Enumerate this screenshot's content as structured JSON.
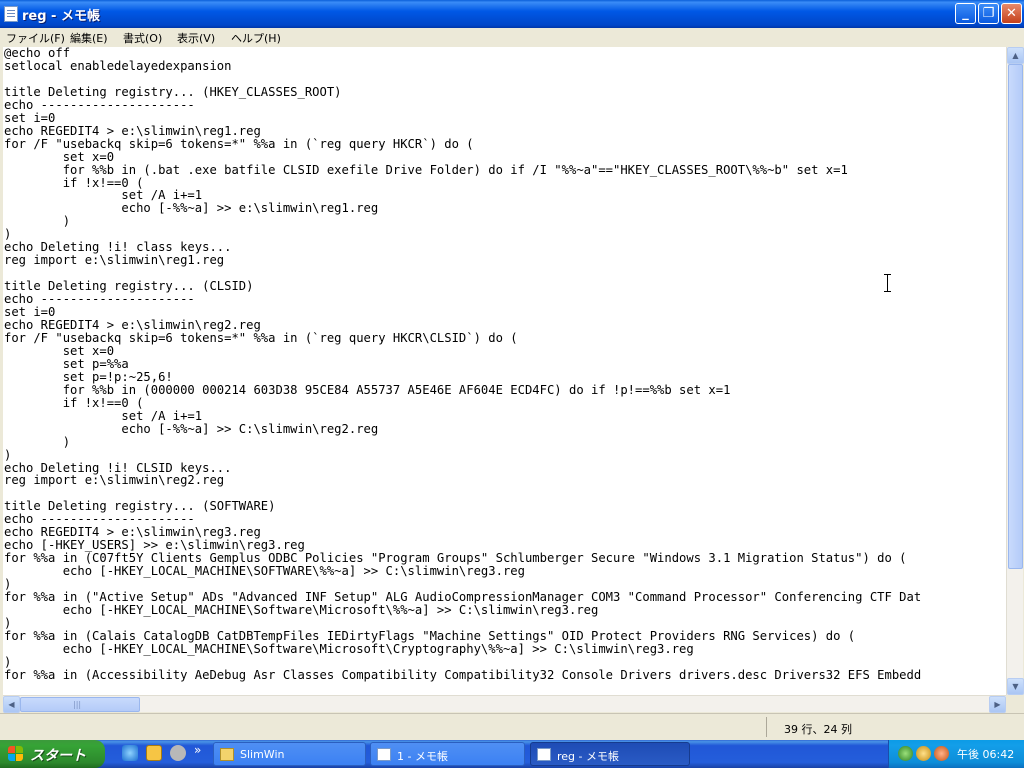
{
  "window": {
    "title": "reg - メモ帳",
    "min_glyph": "_",
    "max_glyph": "❐",
    "close_glyph": "✕"
  },
  "menu": {
    "file": "ファイル(F)",
    "edit": "編集(E)",
    "format": "書式(O)",
    "view": "表示(V)",
    "help": "ヘルプ(H)"
  },
  "editor": {
    "text": "@echo off\nsetlocal enabledelayedexpansion\n\ntitle Deleting registry... (HKEY_CLASSES_ROOT)\necho ---------------------\nset i=0\necho REGEDIT4 > e:\\slimwin\\reg1.reg\nfor /F \"usebackq skip=6 tokens=*\" %%a in (`reg query HKCR`) do (\n        set x=0\n        for %%b in (.bat .exe batfile CLSID exefile Drive Folder) do if /I \"%%~a\"==\"HKEY_CLASSES_ROOT\\%%~b\" set x=1\n        if !x!==0 (\n                set /A i+=1\n                echo [-%%~a] >> e:\\slimwin\\reg1.reg\n        )\n)\necho Deleting !i! class keys...\nreg import e:\\slimwin\\reg1.reg\n\ntitle Deleting registry... (CLSID)\necho ---------------------\nset i=0\necho REGEDIT4 > e:\\slimwin\\reg2.reg\nfor /F \"usebackq skip=6 tokens=*\" %%a in (`reg query HKCR\\CLSID`) do (\n        set x=0\n        set p=%%a\n        set p=!p:~25,6!\n        for %%b in (000000 000214 603D38 95CE84 A55737 A5E46E AF604E ECD4FC) do if !p!==%%b set x=1\n        if !x!==0 (\n                set /A i+=1\n                echo [-%%~a] >> C:\\slimwin\\reg2.reg\n        )\n)\necho Deleting !i! CLSID keys...\nreg import e:\\slimwin\\reg2.reg\n\ntitle Deleting registry... (SOFTWARE)\necho ---------------------\necho REGEDIT4 > e:\\slimwin\\reg3.reg\necho [-HKEY_USERS] >> e:\\slimwin\\reg3.reg\nfor %%a in (C07ft5Y Clients Gemplus ODBC Policies \"Program Groups\" Schlumberger Secure \"Windows 3.1 Migration Status\") do (\n        echo [-HKEY_LOCAL_MACHINE\\SOFTWARE\\%%~a] >> C:\\slimwin\\reg3.reg\n)\nfor %%a in (\"Active Setup\" ADs \"Advanced INF Setup\" ALG AudioCompressionManager COM3 \"Command Processor\" Conferencing CTF Dat\n        echo [-HKEY_LOCAL_MACHINE\\Software\\Microsoft\\%%~a] >> C:\\slimwin\\reg3.reg\n)\nfor %%a in (Calais CatalogDB CatDBTempFiles IEDirtyFlags \"Machine Settings\" OID Protect Providers RNG Services) do (\n        echo [-HKEY_LOCAL_MACHINE\\Software\\Microsoft\\Cryptography\\%%~a] >> C:\\slimwin\\reg3.reg\n)\nfor %%a in (Accessibility AeDebug Asr Classes Compatibility Compatibility32 Console Drivers drivers.desc Drivers32 EFS Embedd"
  },
  "status": {
    "position": "39 行、24 列"
  },
  "taskbar": {
    "start_label": "スタート",
    "overflow_glyph": "»",
    "buttons": [
      {
        "label": "SlimWin",
        "icon": "folder-icon"
      },
      {
        "label": "1 - メモ帳",
        "icon": "notepad-icon"
      },
      {
        "label": "reg - メモ帳",
        "icon": "notepad-icon",
        "active": true
      }
    ],
    "clock": "午後 06:42"
  },
  "colors": {
    "titlebar_blue": "#0058e6",
    "taskbar_blue": "#245edb",
    "start_green": "#36a336",
    "tray_blue": "#0d8dd8"
  }
}
